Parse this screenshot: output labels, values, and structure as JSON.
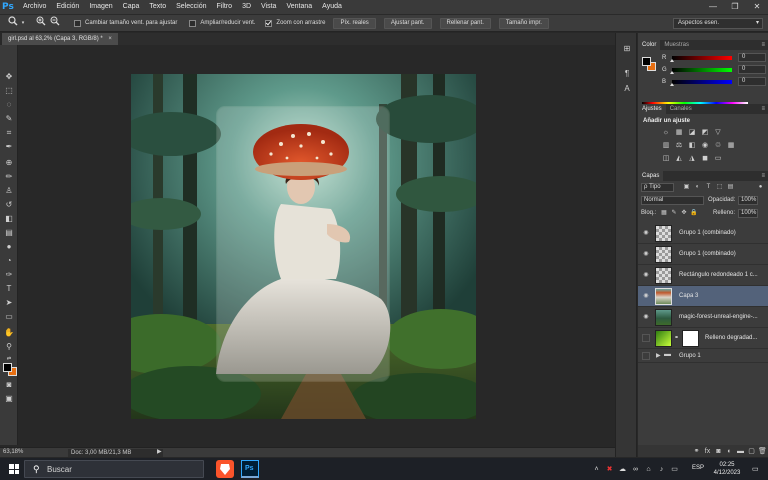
{
  "app": {
    "logo": "Ps"
  },
  "menu": [
    "Archivo",
    "Edición",
    "Imagen",
    "Capa",
    "Texto",
    "Selección",
    "Filtro",
    "3D",
    "Vista",
    "Ventana",
    "Ayuda"
  ],
  "window_controls": {
    "minimize": "—",
    "maximize": "❐",
    "close": "✕"
  },
  "options_bar": {
    "tool_icon": "zoom-icon",
    "check_resize": {
      "label": "Cambiar tamaño vent. para ajustar",
      "checked": false
    },
    "check_zoom_all": {
      "label": "Ampliar/reducir vent.",
      "checked": false
    },
    "check_scrubby": {
      "label": "Zoom con arrastre",
      "checked": true
    },
    "buttons": [
      "Píx. reales",
      "Ajustar pant.",
      "Rellenar pant.",
      "Tamaño impr."
    ],
    "workspace": "Aspectos esen."
  },
  "document": {
    "tab_title": "girl.psd al 63,2% (Capa 3, RGB/8) *",
    "close": "×"
  },
  "status": {
    "zoom": "63,18%",
    "doc_info": "Doc: 3,00 MB/21,3 MB",
    "arrow": "▶"
  },
  "colors": {
    "foreground": "#000000",
    "background": "#e76f12",
    "selection": "#53627a"
  },
  "color_panel": {
    "tabs": [
      "Color",
      "Muestras"
    ],
    "sliders": [
      {
        "letter": "R",
        "value": "0",
        "position": 0
      },
      {
        "letter": "G",
        "value": "0",
        "position": 0
      },
      {
        "letter": "B",
        "value": "0",
        "position": 0
      }
    ]
  },
  "adjustments_panel": {
    "tabs": [
      "Ajustes",
      "Canales"
    ],
    "title": "Añadir un ajuste"
  },
  "layers_panel": {
    "tabs": [
      "Capas"
    ],
    "filter": "ρ Tipo",
    "blend_mode": "Normal",
    "opacity_label": "Opacidad:",
    "opacity": "100%",
    "lock_label": "Bloq.:",
    "fill_label": "Relleno:",
    "fill": "100%",
    "layers": [
      {
        "name": "Grupo 1 (combinado)",
        "visible": true,
        "thumb": "checker"
      },
      {
        "name": "Grupo 1 (combinado)",
        "visible": true,
        "thumb": "checker"
      },
      {
        "name": "Rectángulo redondeado 1 c...",
        "visible": true,
        "thumb": "checker"
      },
      {
        "name": "Capa 3",
        "visible": true,
        "thumb": "girl",
        "selected": true
      },
      {
        "name": "magic-forest-unreal-engine-...",
        "visible": true,
        "thumb": "forest"
      },
      {
        "name": "Relleno degradad...",
        "visible": false,
        "thumb": "gradient"
      },
      {
        "name": "Grupo 1",
        "visible": false,
        "thumb": "folder"
      }
    ]
  },
  "taskbar": {
    "search_placeholder": "Buscar",
    "lang": "ESP",
    "time": "02:25",
    "date": "4/12/2023"
  }
}
